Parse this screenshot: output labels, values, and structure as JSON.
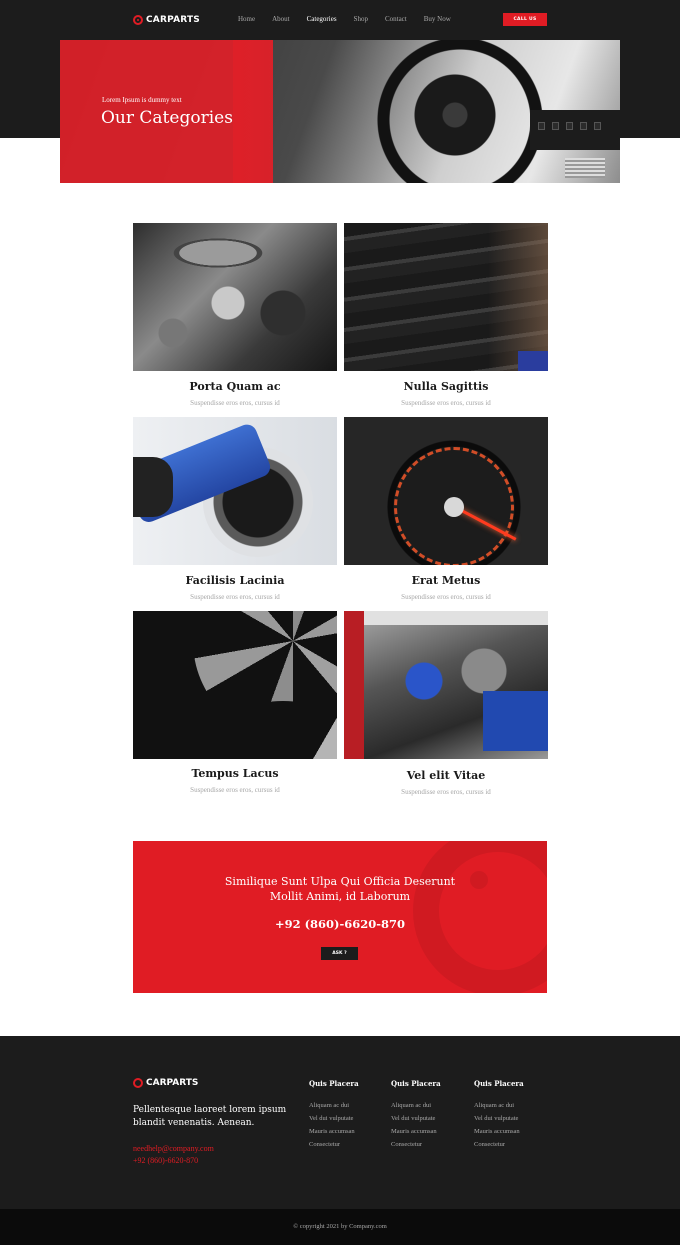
{
  "header": {
    "brand": "CARPARTS",
    "nav": [
      "Home",
      "About",
      "Categories",
      "Shop",
      "Contact",
      "Buy Now"
    ],
    "active_nav": "Categories",
    "call_button": "CALL US"
  },
  "hero": {
    "subtitle": "Lorem Ipsum is dummy text",
    "title": "Our Categories"
  },
  "categories": [
    {
      "title": "Porta Quam ac",
      "subtitle": "Suspendisse eros eros, cursus id",
      "icon": "engine-photo"
    },
    {
      "title": "Nulla Sagittis",
      "subtitle": "Suspendisse eros eros, cursus id",
      "icon": "tyres-photo"
    },
    {
      "title": "Facilisis Lacinia",
      "subtitle": "Suspendisse eros eros, cursus id",
      "icon": "fuel-nozzle-photo"
    },
    {
      "title": "Erat Metus",
      "subtitle": "Suspendisse eros eros, cursus id",
      "icon": "speedometer-photo"
    },
    {
      "title": "Tempus Lacus",
      "subtitle": "Suspendisse eros eros, cursus id",
      "icon": "rims-photo"
    },
    {
      "title": "Vel elit Vitae",
      "subtitle": "Suspendisse eros eros, cursus id",
      "icon": "engine-bay-photo"
    }
  ],
  "cta": {
    "line1": "Similique Sunt Ulpa Qui Officia Deserunt",
    "line2": "Mollit Animi, id Laborum",
    "phone": "+92 (860)-6620-870",
    "button": "ASK ?"
  },
  "footer": {
    "brand": "CARPARTS",
    "description": "Pellentesque laoreet lorem ipsum blandit venenatis. Aenean.",
    "email": "needhelp@company.com",
    "phone": "+92 (860)-6620-870",
    "columns": [
      {
        "heading": "Quis Placera",
        "links": [
          "Aliquam ac dui",
          "Vel dui vulputate",
          "Mauris accumsan",
          "Consectetur"
        ]
      },
      {
        "heading": "Quis Placera",
        "links": [
          "Aliquam ac dui",
          "Vel dui vulputate",
          "Mauris accumsan",
          "Consectetur"
        ]
      },
      {
        "heading": "Quis Placera",
        "links": [
          "Aliquam ac dui",
          "Vel dui vulputate",
          "Mauris accumsan",
          "Consectetur"
        ]
      }
    ],
    "copyright": "© copyright 2021 by Company.com"
  },
  "colors": {
    "accent": "#e01c24",
    "dark": "#1c1c1c"
  }
}
